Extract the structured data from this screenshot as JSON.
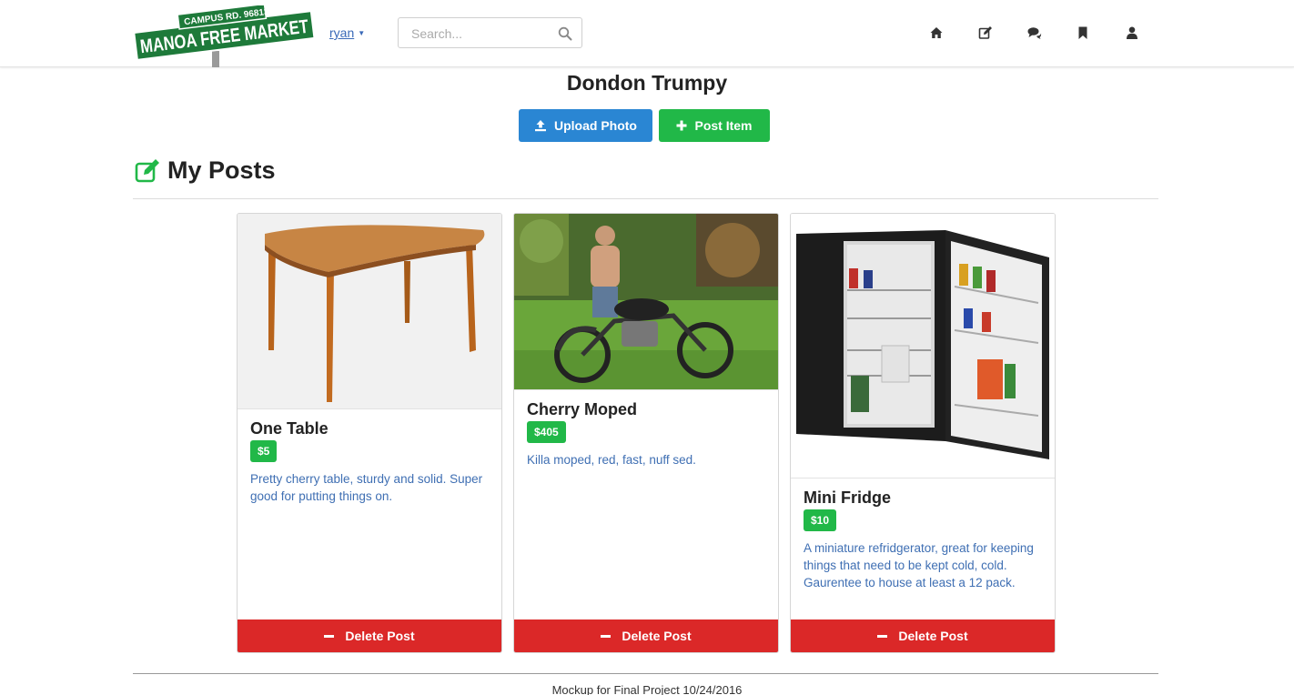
{
  "header": {
    "logo_street": "CAMPUS RD. 96813",
    "logo_text": "MANOA FREE MARKET",
    "user_name": "ryan",
    "search_placeholder": "Search..."
  },
  "nav": {
    "items": [
      {
        "icon": "home-icon"
      },
      {
        "icon": "edit-icon"
      },
      {
        "icon": "comments-icon"
      },
      {
        "icon": "bookmark-icon"
      },
      {
        "icon": "user-icon"
      }
    ]
  },
  "profile": {
    "name": "Dondon Trumpy",
    "upload_label": "Upload Photo",
    "post_label": "Post Item"
  },
  "section": {
    "title": "My Posts"
  },
  "posts": [
    {
      "title": "One Table",
      "price": "$5",
      "description": "Pretty cherry table, sturdy and solid. Super good for putting things on.",
      "delete_label": "Delete Post"
    },
    {
      "title": "Cherry Moped",
      "price": "$405",
      "description": "Killa moped, red, fast, nuff sed.",
      "delete_label": "Delete Post"
    },
    {
      "title": "Mini Fridge",
      "price": "$10",
      "description": "A miniature refridgerator, great for keeping things that need to be kept cold, cold. Gaurentee to house at least a 12 pack.",
      "delete_label": "Delete Post"
    }
  ],
  "footer": {
    "text": "Mockup for Final Project 10/24/2016"
  },
  "colors": {
    "brand_green": "#21b848",
    "primary_blue": "#2a86d3",
    "danger_red": "#db2828",
    "link_blue": "#3f6fb3"
  }
}
